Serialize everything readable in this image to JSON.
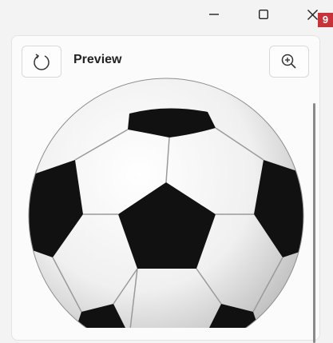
{
  "window": {
    "controls": [
      "minimize",
      "maximize",
      "close"
    ],
    "badge": "9"
  },
  "panel": {
    "title": "Preview",
    "refresh_icon": "refresh-icon",
    "zoom_icon": "zoom-in-icon"
  },
  "image": {
    "subject": "soccer-ball"
  },
  "colors": {
    "background": "#f3f3f3",
    "panel": "#fbfbfb",
    "badge": "#c8323a"
  }
}
